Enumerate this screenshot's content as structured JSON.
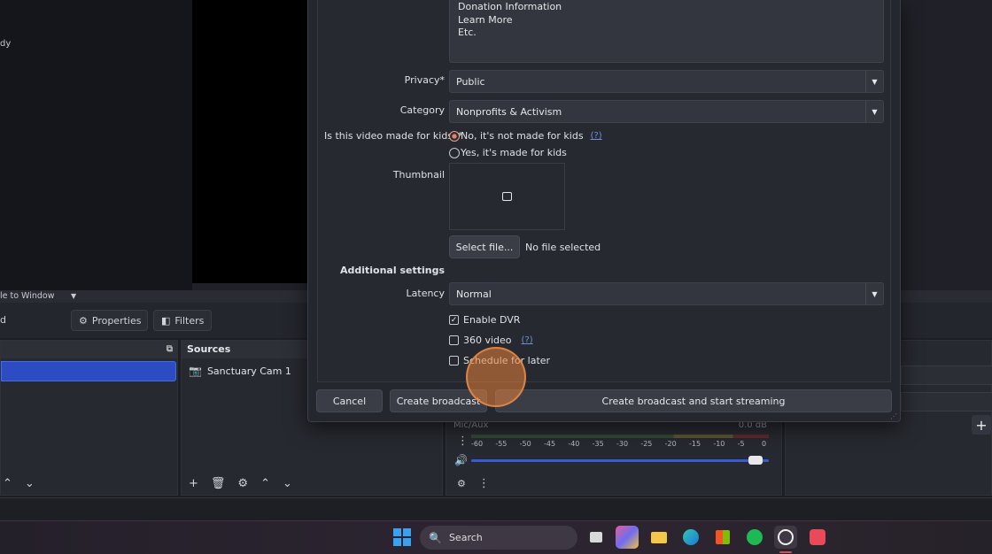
{
  "background": {
    "scale_label": "le to Window",
    "left_toolbar_fragment": "d",
    "properties_label": "Properties",
    "filters_label": "Filters",
    "sources_title": "Sources",
    "source_item": "Sanctuary Cam 1",
    "mixer": {
      "channel": "Mic/Aux",
      "db": "0.0 dB",
      "ticks": [
        "-60",
        "-55",
        "-50",
        "-45",
        "-40",
        "-35",
        "-30",
        "-25",
        "-20",
        "-15",
        "-10",
        "-5",
        "0"
      ],
      "volume_fraction": 0.98
    },
    "status_text": "dy"
  },
  "dialog": {
    "description_lines": [
      "Donation Information",
      "Learn More",
      "Etc."
    ],
    "privacy_label": "Privacy*",
    "privacy_value": "Public",
    "category_label": "Category",
    "category_value": "Nonprofits & Activism",
    "kids_label": "Is this video made for kids?*",
    "kids_no": "No, it's not made for kids",
    "kids_help": "(?)",
    "kids_yes": "Yes, it's made for kids",
    "thumbnail_label": "Thumbnail",
    "select_file_label": "Select file...",
    "no_file_text": "No file selected",
    "additional_settings": "Additional settings",
    "latency_label": "Latency",
    "latency_value": "Normal",
    "enable_dvr": "Enable DVR",
    "video_360": "360 video",
    "video_360_help": "(?)",
    "schedule_later": "Schedule for later",
    "cancel_label": "Cancel",
    "create_label": "Create broadcast",
    "create_stream_label": "Create broadcast and start streaming"
  },
  "taskbar": {
    "search_placeholder": "Search"
  }
}
